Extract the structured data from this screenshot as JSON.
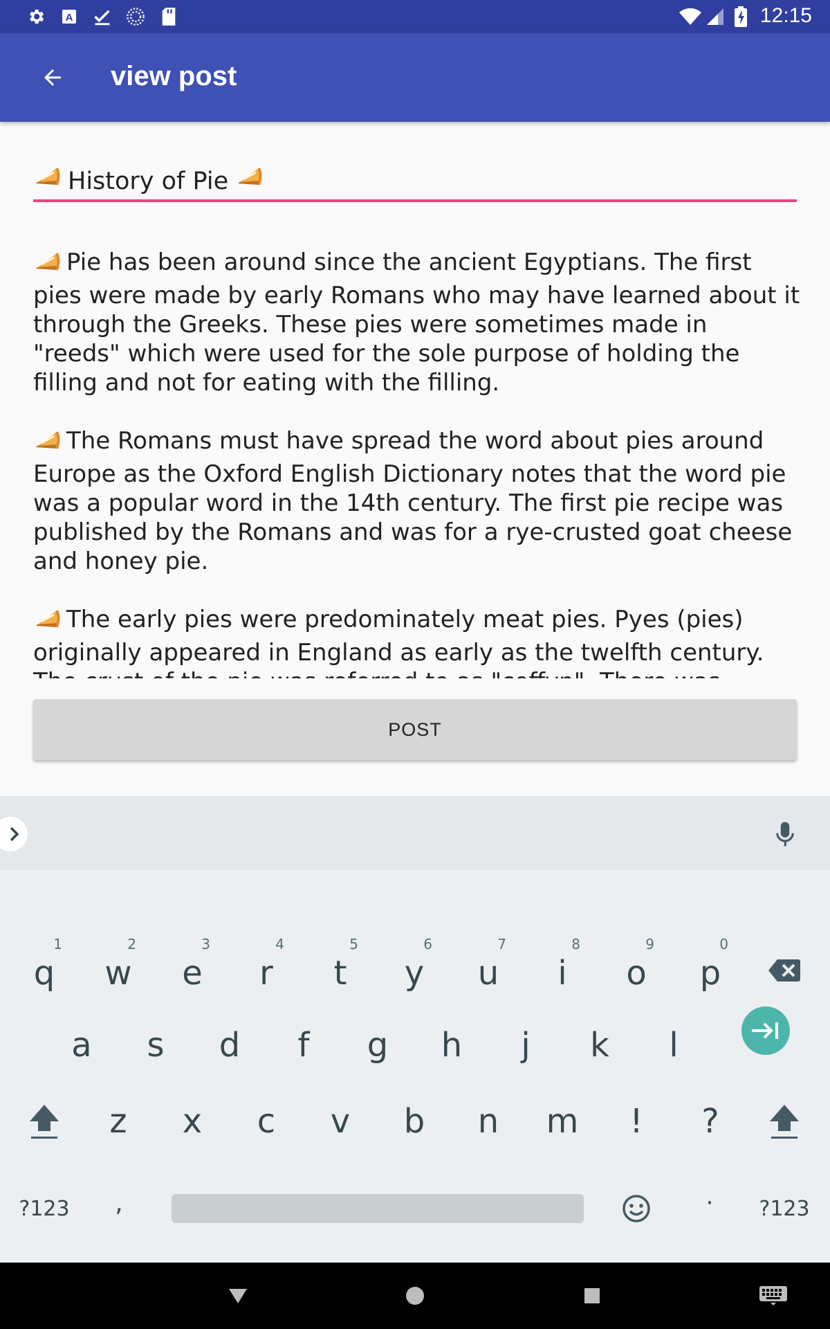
{
  "status_bar": {
    "time": "12:15",
    "left_icons": [
      "settings-icon",
      "text-a-icon",
      "checkmark-icon",
      "loading-circle-icon",
      "sd-card-icon"
    ],
    "right_icons": [
      "wifi-icon",
      "signal-icon",
      "battery-charging-icon"
    ]
  },
  "app_bar": {
    "title": "view post"
  },
  "post": {
    "title": "History of Pie",
    "paragraphs": [
      "Pie has been around since the ancient Egyptians. The first pies were made by early Romans who may have learned about it through the Greeks. These pies were sometimes made in \"reeds\" which were used for the sole purpose of holding the filling and not for eating with the filling.",
      "The Romans must have spread the word about pies around Europe as the Oxford English Dictionary notes that the word pie was a popular word in the 14th century. The first pie recipe was published by the Romans and was for a rye-crusted goat cheese and honey pie.",
      "The early pies were predominately meat pies. Pyes (pies) originally appeared in England as early as the twelfth century. The crust of the pie was referred to as \"coffyn\". There was actually more crust than filling. Often these pies were made using fowl and the"
    ]
  },
  "post_button": {
    "label": "POST"
  },
  "keyboard": {
    "row1": [
      {
        "key": "q",
        "hint": "1"
      },
      {
        "key": "w",
        "hint": "2"
      },
      {
        "key": "e",
        "hint": "3"
      },
      {
        "key": "r",
        "hint": "4"
      },
      {
        "key": "t",
        "hint": "5"
      },
      {
        "key": "y",
        "hint": "6"
      },
      {
        "key": "u",
        "hint": "7"
      },
      {
        "key": "i",
        "hint": "8"
      },
      {
        "key": "o",
        "hint": "9"
      },
      {
        "key": "p",
        "hint": "0"
      }
    ],
    "row2": [
      "a",
      "s",
      "d",
      "f",
      "g",
      "h",
      "j",
      "k",
      "l"
    ],
    "row3": [
      "z",
      "x",
      "c",
      "v",
      "b",
      "n",
      "m",
      "!",
      "?"
    ],
    "symbols_label": "?123",
    "comma": ",",
    "period": "·",
    "accent_color": "#4db6ac"
  },
  "colors": {
    "primary": "#3f51b5",
    "primary_dark": "#303f9f",
    "accent": "#e8457a"
  }
}
